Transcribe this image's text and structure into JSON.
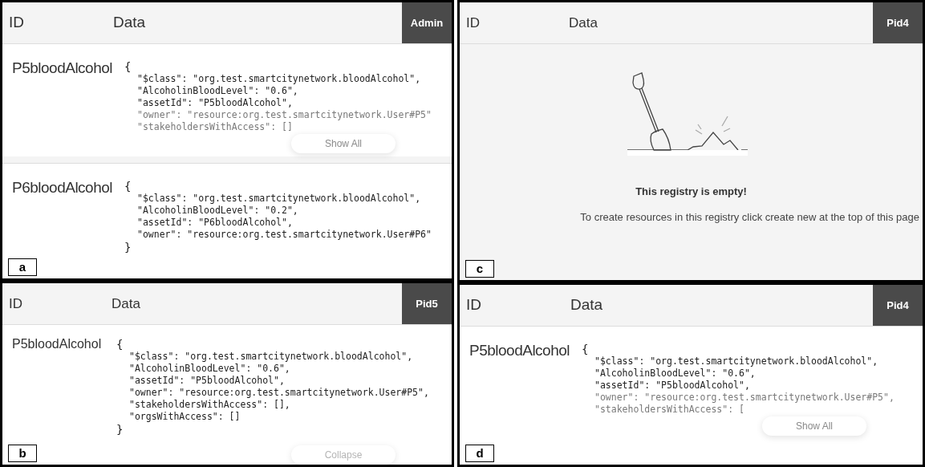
{
  "panels": [
    {
      "label": "a",
      "role": "Admin",
      "columns": [
        "ID",
        "Data"
      ],
      "records": [
        {
          "id": "P5bloodAlcohol",
          "open": "{",
          "lines": [
            {
              "text": "\"$class\": \"org.test.smartcitynetwork.bloodAlcohol\",",
              "faded": false
            },
            {
              "text": "\"AlcoholinBloodLevel\": \"0.6\",",
              "faded": false
            },
            {
              "text": "\"assetId\": \"P5bloodAlcohol\",",
              "faded": false
            },
            {
              "text": "\"owner\": \"resource:org.test.smartcitynetwork.User#P5\"",
              "faded": true
            },
            {
              "text": "\"stakeholdersWithAccess\": []",
              "faded": true
            }
          ],
          "button": {
            "label": "Show All",
            "kind": "expand"
          }
        },
        {
          "id": "P6bloodAlcohol",
          "open": "{",
          "lines": [
            {
              "text": "\"$class\": \"org.test.smartcitynetwork.bloodAlcohol\",",
              "faded": false
            },
            {
              "text": "\"AlcoholinBloodLevel\": \"0.2\",",
              "faded": false
            },
            {
              "text": "\"assetId\": \"P6bloodAlcohol\",",
              "faded": false
            },
            {
              "text": "\"owner\": \"resource:org.test.smartcitynetwork.User#P6\"",
              "faded": false
            }
          ],
          "close": "}"
        }
      ]
    },
    {
      "label": "b",
      "role": "Pid5",
      "columns": [
        "ID",
        "Data"
      ],
      "records": [
        {
          "id": "P5bloodAlcohol",
          "open": "{",
          "lines": [
            {
              "text": "\"$class\": \"org.test.smartcitynetwork.bloodAlcohol\",",
              "faded": false
            },
            {
              "text": "\"AlcoholinBloodLevel\": \"0.6\",",
              "faded": false
            },
            {
              "text": "\"assetId\": \"P5bloodAlcohol\",",
              "faded": false
            },
            {
              "text": "\"owner\": \"resource:org.test.smartcitynetwork.User#P5\",",
              "faded": false
            },
            {
              "text": "\"stakeholdersWithAccess\": [],",
              "faded": false
            },
            {
              "text": "\"orgsWithAccess\": []",
              "faded": false
            }
          ],
          "close": "}",
          "button": {
            "label": "Collapse",
            "kind": "collapse"
          }
        }
      ]
    },
    {
      "label": "c",
      "role": "Pid4",
      "columns": [
        "ID",
        "Data"
      ],
      "empty": {
        "title": "This registry is empty!",
        "message": "To create resources in this registry click create new at the top of this page"
      }
    },
    {
      "label": "d",
      "role": "Pid4",
      "columns": [
        "ID",
        "Data"
      ],
      "records": [
        {
          "id": "P5bloodAlcohol",
          "open": "{",
          "lines": [
            {
              "text": "\"$class\": \"org.test.smartcitynetwork.bloodAlcohol\",",
              "faded": false
            },
            {
              "text": "\"AlcoholinBloodLevel\": \"0.6\",",
              "faded": false
            },
            {
              "text": "\"assetId\": \"P5bloodAlcohol\",",
              "faded": false
            },
            {
              "text": "\"owner\": \"resource:org.test.smartcitynetwork.User#P5\",",
              "faded": true
            },
            {
              "text": "\"stakeholdersWithAccess\": [",
              "faded": true
            }
          ],
          "button": {
            "label": "Show All",
            "kind": "expand"
          }
        }
      ]
    }
  ]
}
